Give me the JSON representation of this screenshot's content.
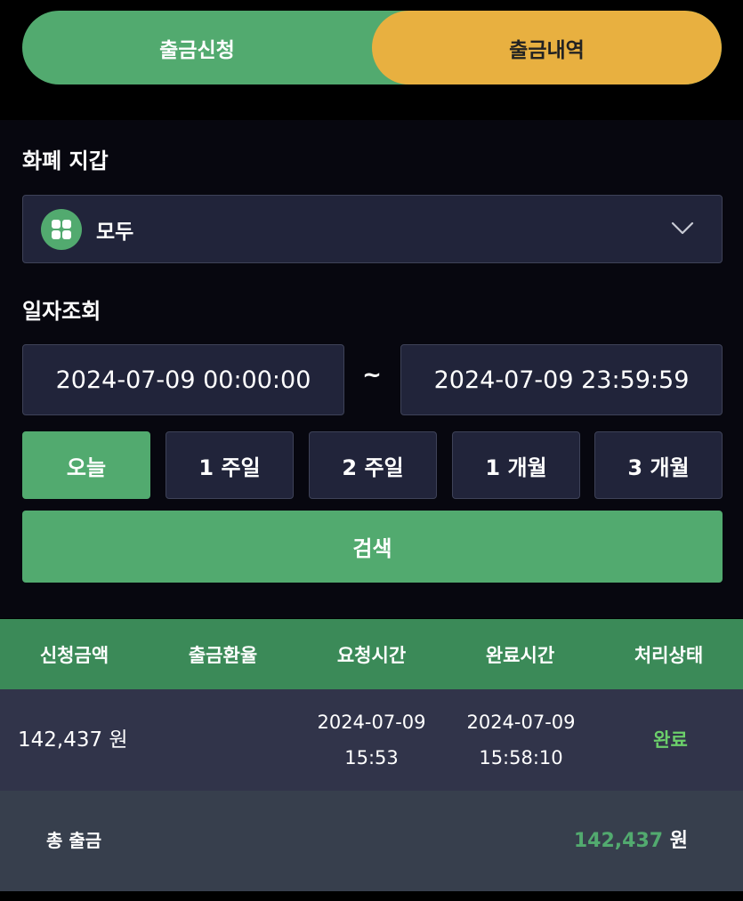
{
  "tabs": {
    "request": "출금신청",
    "history": "출금내역"
  },
  "wallet": {
    "label": "화폐 지갑",
    "selected": "모두",
    "icon": "grid-icon"
  },
  "date_query": {
    "label": "일자조회",
    "start": "2024-07-09 00:00:00",
    "separator": "~",
    "end": "2024-07-09 23:59:59"
  },
  "periods": [
    {
      "label": "오늘",
      "active": true
    },
    {
      "label": "1 주일",
      "active": false
    },
    {
      "label": "2 주일",
      "active": false
    },
    {
      "label": "1 개월",
      "active": false
    },
    {
      "label": "3 개월",
      "active": false
    }
  ],
  "search_label": "검색",
  "table": {
    "headers": [
      "신청금액",
      "출금환율",
      "요청시간",
      "완료시간",
      "처리상태"
    ],
    "rows": [
      {
        "amount": "142,437 원",
        "rate": "",
        "request_date": "2024-07-09",
        "request_time": "15:53",
        "complete_date": "2024-07-09",
        "complete_time": "15:58:10",
        "status": "완료"
      }
    ]
  },
  "total": {
    "label": "총 출금",
    "amount": "142,437",
    "unit": "원"
  },
  "colors": {
    "accent_green": "#52aa6f",
    "accent_orange": "#e8b040",
    "status_complete": "#6bcf6a"
  }
}
